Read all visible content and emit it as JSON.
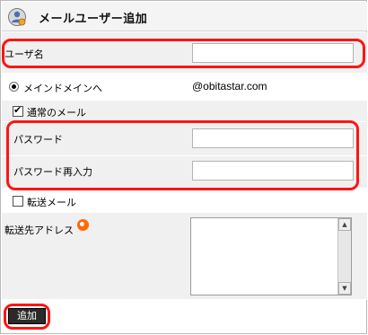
{
  "title": "メールユーザー追加",
  "icons": {
    "title": "user-settings-icon",
    "help": "help-lifebuoy-icon"
  },
  "form": {
    "username_label": "ユーザ名",
    "username_value": "",
    "domain_option_label": "メインドメインへ",
    "domain_value": "@obitastar.com",
    "normal_mail_label": "通常のメール",
    "normal_mail_checked": true,
    "password_label": "パスワード",
    "password_value": "",
    "password_confirm_label": "パスワード再入力",
    "password_confirm_value": "",
    "forward_mail_label": "転送メール",
    "forward_mail_checked": false,
    "forward_address_label": "転送先アドレス",
    "forward_address_value": ""
  },
  "actions": {
    "add_label": "追加"
  },
  "colors": {
    "highlight": "#ff1414",
    "row_bg": "#f0f0f0",
    "button_bg": "#2a2a2a"
  }
}
